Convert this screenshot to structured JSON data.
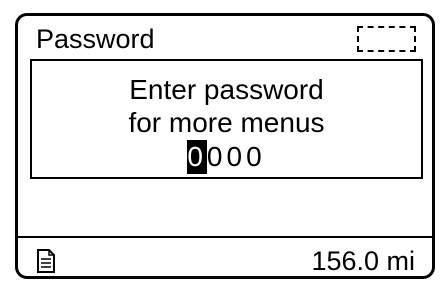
{
  "header": {
    "title": "Password"
  },
  "prompt": {
    "line1": "Enter password",
    "line2": "for more menus",
    "digits": [
      "0",
      "0",
      "0",
      "0"
    ],
    "active_digit_index": 0
  },
  "footer": {
    "distance": "156.0 mi",
    "left_icon": "document-icon"
  },
  "colors": {
    "foreground": "#000000",
    "background": "#ffffff"
  }
}
